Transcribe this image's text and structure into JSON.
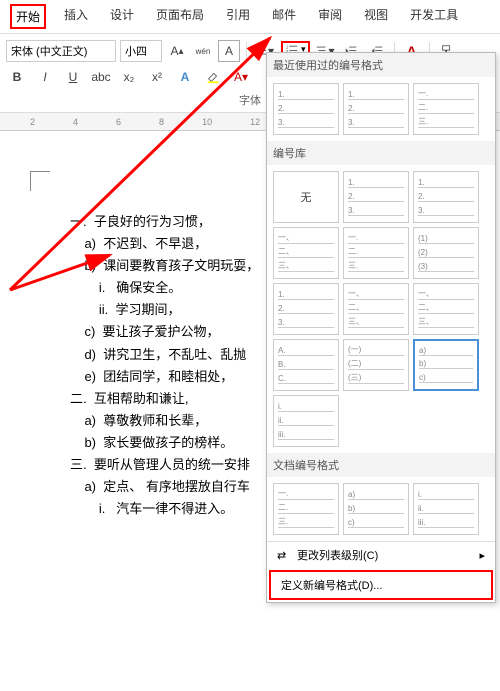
{
  "tabs": {
    "t0": "开始",
    "t1": "插入",
    "t2": "设计",
    "t3": "页面布局",
    "t4": "引用",
    "t5": "邮件",
    "t6": "审阅",
    "t7": "视图",
    "t8": "开发工具"
  },
  "toolbar": {
    "font_name": "宋体 (中文正文)",
    "font_size": "小四",
    "wen": "wén",
    "group_font": "字体"
  },
  "ruler": {
    "m2": "2",
    "m4": "4",
    "m6": "6",
    "m8": "8",
    "m10": "10",
    "m12": "12"
  },
  "doc": {
    "l1": "一.  子良好的行为习惯，",
    "l2": "    a)  不迟到、不早退，",
    "l3": "    b)  课间要教育孩子文明玩耍，",
    "l4": "        i.   确保安全。",
    "l5": "        ii.  学习期间，",
    "l6": "    c)  要让孩子爱护公物，",
    "l7": "    d)  讲究卫生，不乱吐、乱抛",
    "l8": "    e)  团结同学，和睦相处，",
    "l9": "二.  互相帮助和谦让,",
    "l10": "    a)  尊敬教师和长辈，",
    "l11": "    b)  家长要做孩子的榜样。",
    "l12": "三.  要听从管理人员的统一安排",
    "l13": "    a)  定点、 有序地摆放自行车",
    "l14": "        i.   汽车一律不得进入。"
  },
  "dropdown": {
    "sec_recent": "最近使用过的编号格式",
    "sec_library": "编号库",
    "sec_doc": "文档编号格式",
    "none_label": "无",
    "footer_change": "更改列表级别(C)",
    "footer_define": "定义新编号格式(D)...",
    "th_123_1": "1.",
    "th_123_2": "2.",
    "th_123_3": "3.",
    "th_cn_1": "一、",
    "th_cn_2": "二、",
    "th_cn_3": "三、",
    "th_cnd_1": "一.",
    "th_cnd_2": "二.",
    "th_cnd_3": "三.",
    "th_paren_1": "(1)",
    "th_paren_2": "(2)",
    "th_paren_3": "(3)",
    "th_big_1": "A.",
    "th_big_2": "B.",
    "th_big_3": "C.",
    "th_cnp_1": "(一)",
    "th_cnp_2": "(二)",
    "th_cnp_3": "(三)",
    "th_abc_1": "a)",
    "th_abc_2": "b)",
    "th_abc_3": "c)",
    "th_rom_1": "i.",
    "th_rom_2": "ii.",
    "th_rom_3": "iii."
  }
}
